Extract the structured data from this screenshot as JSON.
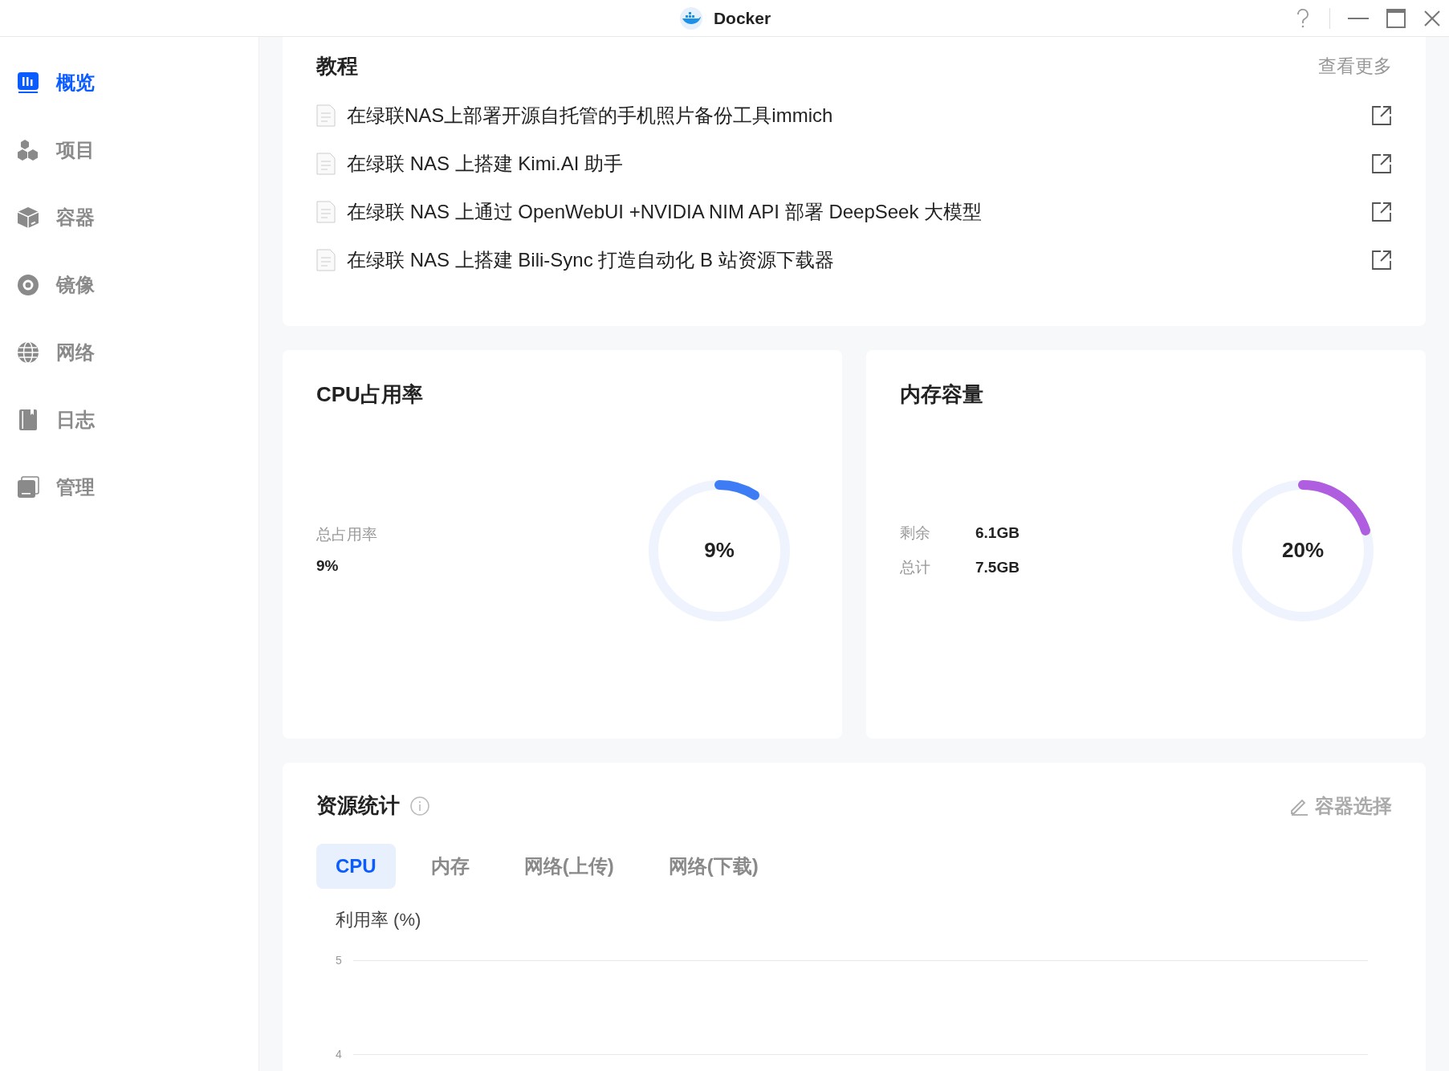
{
  "window": {
    "title": "Docker"
  },
  "sidebar": {
    "items": [
      {
        "label": "概览",
        "kind": "overview",
        "selected": true
      },
      {
        "label": "项目",
        "kind": "project",
        "selected": false
      },
      {
        "label": "容器",
        "kind": "container",
        "selected": false
      },
      {
        "label": "镜像",
        "kind": "image",
        "selected": false
      },
      {
        "label": "网络",
        "kind": "network",
        "selected": false
      },
      {
        "label": "日志",
        "kind": "log",
        "selected": false
      },
      {
        "label": "管理",
        "kind": "manage",
        "selected": false
      }
    ]
  },
  "tutorials": {
    "title": "教程",
    "more": "查看更多",
    "items": [
      "在绿联NAS上部署开源自托管的手机照片备份工具immich",
      "在绿联 NAS 上搭建 Kimi.AI 助手",
      "在绿联 NAS 上通过 OpenWebUI +NVIDIA NIM API 部署 DeepSeek 大模型",
      "在绿联 NAS 上搭建 Bili-Sync 打造自动化 B 站资源下载器"
    ]
  },
  "cpu": {
    "title": "CPU占用率",
    "stats": [
      {
        "label": "总占用率",
        "value": "9%"
      }
    ],
    "gauge": {
      "reading": "9%",
      "level": 0.09,
      "color": "#3d7cf5"
    }
  },
  "memory": {
    "title": "内存容量",
    "stats": [
      {
        "label": "剩余",
        "value": "6.1GB"
      },
      {
        "label": "总计",
        "value": "7.5GB"
      }
    ],
    "gauge": {
      "reading": "20%",
      "level": 0.2,
      "color": "#b05ee0"
    }
  },
  "resources": {
    "title": "资源统计",
    "action": "容器选择",
    "tabs": [
      {
        "label": "CPU",
        "selected": true
      },
      {
        "label": "内存",
        "selected": false
      },
      {
        "label": "网络(上传)",
        "selected": false
      },
      {
        "label": "网络(下载)",
        "selected": false
      }
    ],
    "chart": {
      "ylabel": "利用率 (%)",
      "yticks": [
        "5",
        "4"
      ]
    }
  }
}
